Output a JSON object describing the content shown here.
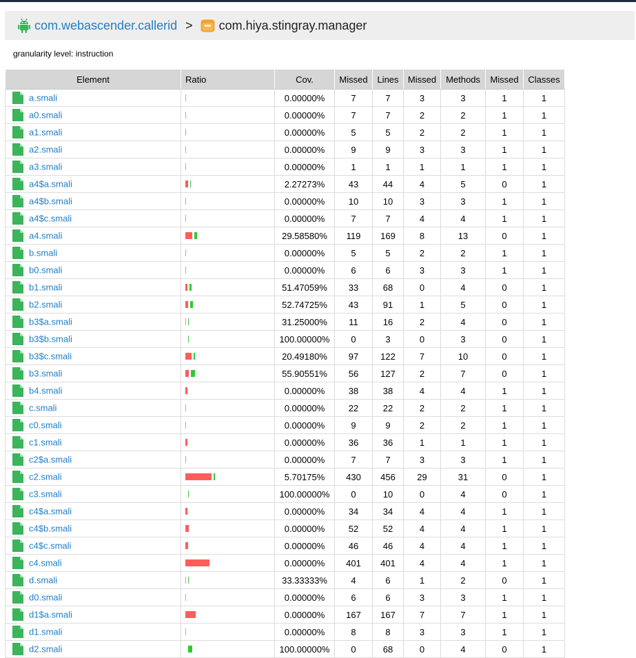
{
  "breadcrumb": {
    "root_icon": "android-icon",
    "root_label": "com.webascender.callerid",
    "separator": ">",
    "current_icon": "package-icon",
    "current_label": "com.hiya.stingray.manager"
  },
  "granularity_text": "granularity level: instruction",
  "table": {
    "headers": [
      "Element",
      "Ratio",
      "Cov.",
      "Missed",
      "Lines",
      "Missed",
      "Methods",
      "Missed",
      "Classes"
    ],
    "rows": [
      {
        "name": "a.smali",
        "cov": "0.00000%",
        "missed": "7",
        "lines": "7",
        "missed_methods": "3",
        "methods": "3",
        "missed_classes": "1",
        "classes": "1",
        "covered_fraction": 0.0
      },
      {
        "name": "a0.smali",
        "cov": "0.00000%",
        "missed": "7",
        "lines": "7",
        "missed_methods": "2",
        "methods": "2",
        "missed_classes": "1",
        "classes": "1",
        "covered_fraction": 0.0
      },
      {
        "name": "a1.smali",
        "cov": "0.00000%",
        "missed": "5",
        "lines": "5",
        "missed_methods": "2",
        "methods": "2",
        "missed_classes": "1",
        "classes": "1",
        "covered_fraction": 0.0
      },
      {
        "name": "a2.smali",
        "cov": "0.00000%",
        "missed": "9",
        "lines": "9",
        "missed_methods": "3",
        "methods": "3",
        "missed_classes": "1",
        "classes": "1",
        "covered_fraction": 0.0
      },
      {
        "name": "a3.smali",
        "cov": "0.00000%",
        "missed": "1",
        "lines": "1",
        "missed_methods": "1",
        "methods": "1",
        "missed_classes": "1",
        "classes": "1",
        "covered_fraction": 0.0
      },
      {
        "name": "a4$a.smali",
        "cov": "2.27273%",
        "missed": "43",
        "lines": "44",
        "missed_methods": "4",
        "methods": "5",
        "missed_classes": "0",
        "classes": "1",
        "covered_fraction": 0.0227
      },
      {
        "name": "a4$b.smali",
        "cov": "0.00000%",
        "missed": "10",
        "lines": "10",
        "missed_methods": "3",
        "methods": "3",
        "missed_classes": "1",
        "classes": "1",
        "covered_fraction": 0.0
      },
      {
        "name": "a4$c.smali",
        "cov": "0.00000%",
        "missed": "7",
        "lines": "7",
        "missed_methods": "4",
        "methods": "4",
        "missed_classes": "1",
        "classes": "1",
        "covered_fraction": 0.0
      },
      {
        "name": "a4.smali",
        "cov": "29.58580%",
        "missed": "119",
        "lines": "169",
        "missed_methods": "8",
        "methods": "13",
        "missed_classes": "0",
        "classes": "1",
        "covered_fraction": 0.2959
      },
      {
        "name": "b.smali",
        "cov": "0.00000%",
        "missed": "5",
        "lines": "5",
        "missed_methods": "2",
        "methods": "2",
        "missed_classes": "1",
        "classes": "1",
        "covered_fraction": 0.0
      },
      {
        "name": "b0.smali",
        "cov": "0.00000%",
        "missed": "6",
        "lines": "6",
        "missed_methods": "3",
        "methods": "3",
        "missed_classes": "1",
        "classes": "1",
        "covered_fraction": 0.0
      },
      {
        "name": "b1.smali",
        "cov": "51.47059%",
        "missed": "33",
        "lines": "68",
        "missed_methods": "0",
        "methods": "4",
        "missed_classes": "0",
        "classes": "1",
        "covered_fraction": 0.5147
      },
      {
        "name": "b2.smali",
        "cov": "52.74725%",
        "missed": "43",
        "lines": "91",
        "missed_methods": "1",
        "methods": "5",
        "missed_classes": "0",
        "classes": "1",
        "covered_fraction": 0.5275
      },
      {
        "name": "b3$a.smali",
        "cov": "31.25000%",
        "missed": "11",
        "lines": "16",
        "missed_methods": "2",
        "methods": "4",
        "missed_classes": "0",
        "classes": "1",
        "covered_fraction": 0.3125
      },
      {
        "name": "b3$b.smali",
        "cov": "100.00000%",
        "missed": "0",
        "lines": "3",
        "missed_methods": "0",
        "methods": "3",
        "missed_classes": "0",
        "classes": "1",
        "covered_fraction": 1.0
      },
      {
        "name": "b3$c.smali",
        "cov": "20.49180%",
        "missed": "97",
        "lines": "122",
        "missed_methods": "7",
        "methods": "10",
        "missed_classes": "0",
        "classes": "1",
        "covered_fraction": 0.2049
      },
      {
        "name": "b3.smali",
        "cov": "55.90551%",
        "missed": "56",
        "lines": "127",
        "missed_methods": "2",
        "methods": "7",
        "missed_classes": "0",
        "classes": "1",
        "covered_fraction": 0.5591
      },
      {
        "name": "b4.smali",
        "cov": "0.00000%",
        "missed": "38",
        "lines": "38",
        "missed_methods": "4",
        "methods": "4",
        "missed_classes": "1",
        "classes": "1",
        "covered_fraction": 0.0
      },
      {
        "name": "c.smali",
        "cov": "0.00000%",
        "missed": "22",
        "lines": "22",
        "missed_methods": "2",
        "methods": "2",
        "missed_classes": "1",
        "classes": "1",
        "covered_fraction": 0.0
      },
      {
        "name": "c0.smali",
        "cov": "0.00000%",
        "missed": "9",
        "lines": "9",
        "missed_methods": "2",
        "methods": "2",
        "missed_classes": "1",
        "classes": "1",
        "covered_fraction": 0.0
      },
      {
        "name": "c1.smali",
        "cov": "0.00000%",
        "missed": "36",
        "lines": "36",
        "missed_methods": "1",
        "methods": "1",
        "missed_classes": "1",
        "classes": "1",
        "covered_fraction": 0.0
      },
      {
        "name": "c2$a.smali",
        "cov": "0.00000%",
        "missed": "7",
        "lines": "7",
        "missed_methods": "3",
        "methods": "3",
        "missed_classes": "1",
        "classes": "1",
        "covered_fraction": 0.0
      },
      {
        "name": "c2.smali",
        "cov": "5.70175%",
        "missed": "430",
        "lines": "456",
        "missed_methods": "29",
        "methods": "31",
        "missed_classes": "0",
        "classes": "1",
        "covered_fraction": 0.057
      },
      {
        "name": "c3.smali",
        "cov": "100.00000%",
        "missed": "0",
        "lines": "10",
        "missed_methods": "0",
        "methods": "4",
        "missed_classes": "0",
        "classes": "1",
        "covered_fraction": 1.0
      },
      {
        "name": "c4$a.smali",
        "cov": "0.00000%",
        "missed": "34",
        "lines": "34",
        "missed_methods": "4",
        "methods": "4",
        "missed_classes": "1",
        "classes": "1",
        "covered_fraction": 0.0
      },
      {
        "name": "c4$b.smali",
        "cov": "0.00000%",
        "missed": "52",
        "lines": "52",
        "missed_methods": "4",
        "methods": "4",
        "missed_classes": "1",
        "classes": "1",
        "covered_fraction": 0.0
      },
      {
        "name": "c4$c.smali",
        "cov": "0.00000%",
        "missed": "46",
        "lines": "46",
        "missed_methods": "4",
        "methods": "4",
        "missed_classes": "1",
        "classes": "1",
        "covered_fraction": 0.0
      },
      {
        "name": "c4.smali",
        "cov": "0.00000%",
        "missed": "401",
        "lines": "401",
        "missed_methods": "4",
        "methods": "4",
        "missed_classes": "1",
        "classes": "1",
        "covered_fraction": 0.0
      },
      {
        "name": "d.smali",
        "cov": "33.33333%",
        "missed": "4",
        "lines": "6",
        "missed_methods": "1",
        "methods": "2",
        "missed_classes": "0",
        "classes": "1",
        "covered_fraction": 0.3333
      },
      {
        "name": "d0.smali",
        "cov": "0.00000%",
        "missed": "6",
        "lines": "6",
        "missed_methods": "3",
        "methods": "3",
        "missed_classes": "1",
        "classes": "1",
        "covered_fraction": 0.0
      },
      {
        "name": "d1$a.smali",
        "cov": "0.00000%",
        "missed": "167",
        "lines": "167",
        "missed_methods": "7",
        "methods": "7",
        "missed_classes": "1",
        "classes": "1",
        "covered_fraction": 0.0
      },
      {
        "name": "d1.smali",
        "cov": "0.00000%",
        "missed": "8",
        "lines": "8",
        "missed_methods": "3",
        "methods": "3",
        "missed_classes": "1",
        "classes": "1",
        "covered_fraction": 0.0
      },
      {
        "name": "d2.smali",
        "cov": "100.00000%",
        "missed": "0",
        "lines": "68",
        "missed_methods": "0",
        "methods": "4",
        "missed_classes": "0",
        "classes": "1",
        "covered_fraction": 1.0
      }
    ]
  },
  "colors": {
    "link": "#1f7fc8",
    "missed_bar": "#ff5c5c",
    "covered_bar": "#2dcc2d",
    "file_icon": "#3cb45c",
    "header_bg": "#d6d6d6",
    "breadcrumb_bg": "#eeeeee"
  },
  "icons": {
    "file": "file-icon"
  }
}
